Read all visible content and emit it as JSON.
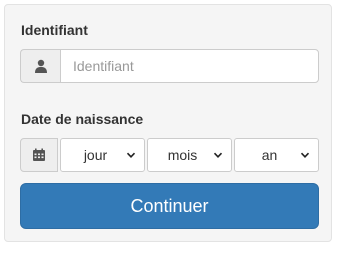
{
  "form": {
    "identifier_label": "Identifiant",
    "identifier_placeholder": "Identifiant",
    "identifier_value": "",
    "dob_label": "Date de naissance",
    "day_select": {
      "selected": "jour"
    },
    "month_select": {
      "selected": "mois"
    },
    "year_select": {
      "selected": "an"
    },
    "submit_label": "Continuer"
  },
  "icons": {
    "identifier_addon": "user-icon",
    "dob_addon": "calendar-icon"
  },
  "colors": {
    "panel_background": "#f5f5f5",
    "button_background": "#337ab7",
    "button_text": "#ffffff",
    "addon_background": "#eeeeee"
  }
}
